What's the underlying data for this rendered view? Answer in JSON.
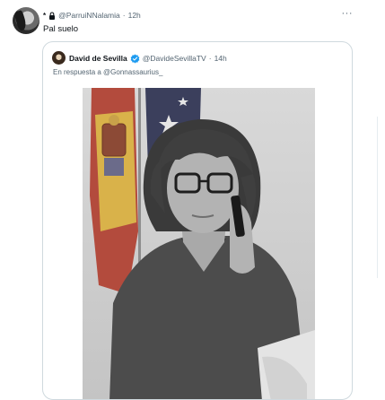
{
  "tweet": {
    "display_name_prefix": "*",
    "handle": "@ParruiNNalamia",
    "separator": "·",
    "time": "12h",
    "more_label": "···",
    "text": "Pal suelo"
  },
  "quoted": {
    "name": "David de Sevilla",
    "handle": "@DavideSevillaTV",
    "separator": "·",
    "time": "14h",
    "reply_prefix": "En respuesta a",
    "reply_handle": "@Gonnassaurius_"
  },
  "colors": {
    "verified": "#1d9bf0",
    "secondary_text": "#536471",
    "border": "#cfd9de"
  },
  "icons": [
    "lock-icon",
    "verified-badge-icon",
    "more-options-icon"
  ]
}
